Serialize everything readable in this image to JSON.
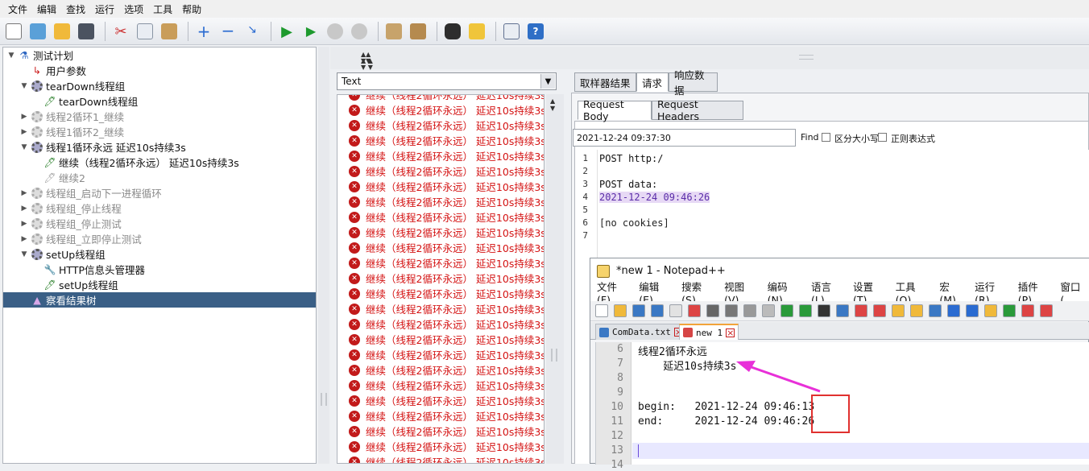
{
  "menubar": [
    "文件",
    "编辑",
    "查找",
    "运行",
    "选项",
    "工具",
    "帮助"
  ],
  "tree": [
    {
      "label": "测试计划",
      "toggle": "▼",
      "icon": "flask-icon"
    },
    {
      "label": "用户参数",
      "toggle": "",
      "icon": "user-params-icon"
    },
    {
      "label": "tearDown线程组",
      "toggle": "▼",
      "icon": "gear-icon"
    },
    {
      "label": "tearDown线程组",
      "toggle": "",
      "icon": "sampler-icon"
    },
    {
      "label": "线程2循环1_继续",
      "toggle": "▶",
      "icon": "gear-icon"
    },
    {
      "label": "线程1循环2_继续",
      "toggle": "▶",
      "icon": "gear-icon"
    },
    {
      "label": "线程1循环永远  延迟10s持续3s",
      "toggle": "▼",
      "icon": "gear-icon"
    },
    {
      "label": "继续（线程2循环永远）  延迟10s持续3s",
      "toggle": "",
      "icon": "sampler-icon"
    },
    {
      "label": "继续2",
      "toggle": "",
      "icon": "sampler-icon"
    },
    {
      "label": "线程组_启动下一进程循环",
      "toggle": "▶",
      "icon": "gear-icon"
    },
    {
      "label": "线程组_停止线程",
      "toggle": "▶",
      "icon": "gear-icon"
    },
    {
      "label": "线程组_停止测试",
      "toggle": "▶",
      "icon": "gear-icon"
    },
    {
      "label": "线程组_立即停止测试",
      "toggle": "▶",
      "icon": "gear-icon"
    },
    {
      "label": "setUp线程组",
      "toggle": "▼",
      "icon": "gear-icon"
    },
    {
      "label": "HTTP信息头管理器",
      "toggle": "",
      "icon": "wrench-icon"
    },
    {
      "label": "setUp线程组",
      "toggle": "",
      "icon": "sampler-icon"
    },
    {
      "label": "察看结果树",
      "toggle": "",
      "icon": "results-tree-icon"
    }
  ],
  "results": {
    "renderer": "Text",
    "item_label": "继续（线程2循环永远）  延迟10s持续3s"
  },
  "right_panel": {
    "tabs": [
      "取样器结果",
      "请求",
      "响应数据"
    ],
    "subtabs": [
      "Request Body",
      "Request Headers"
    ],
    "search_value": "2021-12-24 09:37:30",
    "find_label": "Find",
    "case_label": "区分大小写",
    "regex_label": "正则表达式",
    "code_lines": [
      "POST http:/",
      "",
      "POST data:",
      "2021-12-24 09:46:26",
      "",
      "[no cookies]",
      ""
    ]
  },
  "notepad": {
    "title": "*new 1 - Notepad++",
    "menu": [
      "文件(F)",
      "编辑(E)",
      "搜索(S)",
      "视图(V)",
      "编码(N)",
      "语言(L)",
      "设置(T)",
      "工具(O)",
      "宏(M)",
      "运行(R)",
      "插件(P)",
      "窗口("
    ],
    "tabs": [
      "ComData.txt",
      "new 1"
    ],
    "line_numbers": [
      "6",
      "7",
      "8",
      "9",
      "10",
      "11",
      "12",
      "13",
      "14"
    ],
    "lines": [
      "线程2循环永远",
      "    延迟10s持续3s",
      "",
      "",
      "begin:   2021-12-24 09:46:13",
      "end:     2021-12-24 09:46:26",
      "",
      "",
      ""
    ]
  },
  "colors": {
    "accent": "#3a5f86",
    "error": "#d41313",
    "highlight": "#e0312f",
    "arrow": "#e830d8"
  }
}
